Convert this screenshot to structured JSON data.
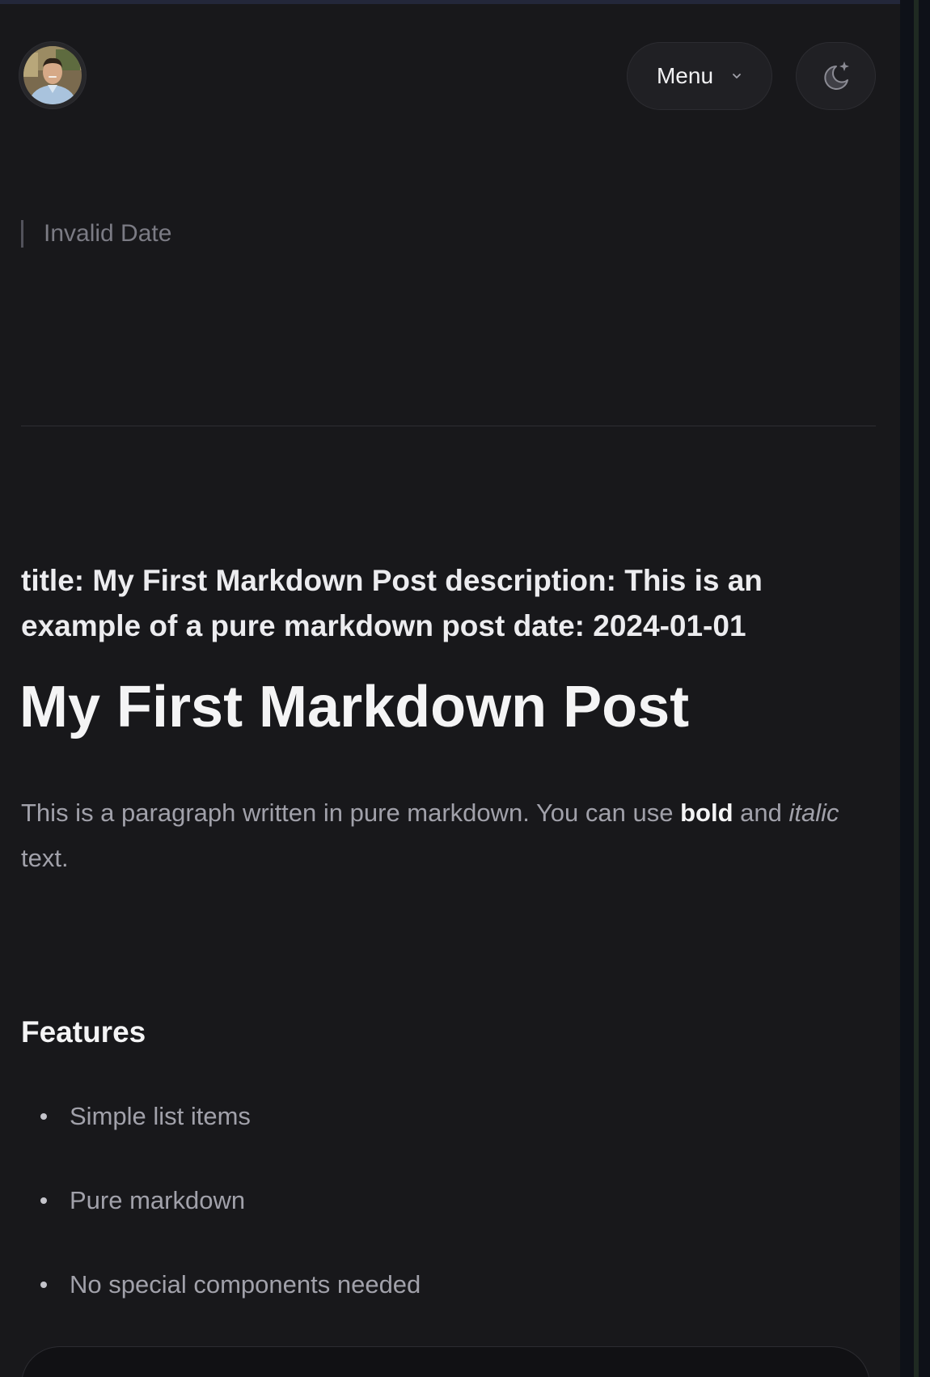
{
  "header": {
    "menu_label": "Menu",
    "avatar_alt": "avatar",
    "theme_toggle_icon": "moon-sparkle-icon",
    "chevron_icon": "chevron-down-icon"
  },
  "post": {
    "date": "Invalid Date",
    "front_matter": "title: My First Markdown Post description: This is an example of a pure markdown post date: 2024-01-01",
    "title": "My First Markdown Post",
    "intro": {
      "part1": "This is a paragraph written in pure markdown. You can use ",
      "bold": "bold",
      "part2": " and ",
      "italic": "italic",
      "part3": " text."
    },
    "features_heading": "Features",
    "features": [
      "Simple list items",
      "Pure markdown",
      "No special components needed"
    ]
  },
  "colors": {
    "background": "#18181b",
    "text_primary": "#f4f4f5",
    "text_muted": "#a1a1aa",
    "button_bg": "#202024"
  }
}
